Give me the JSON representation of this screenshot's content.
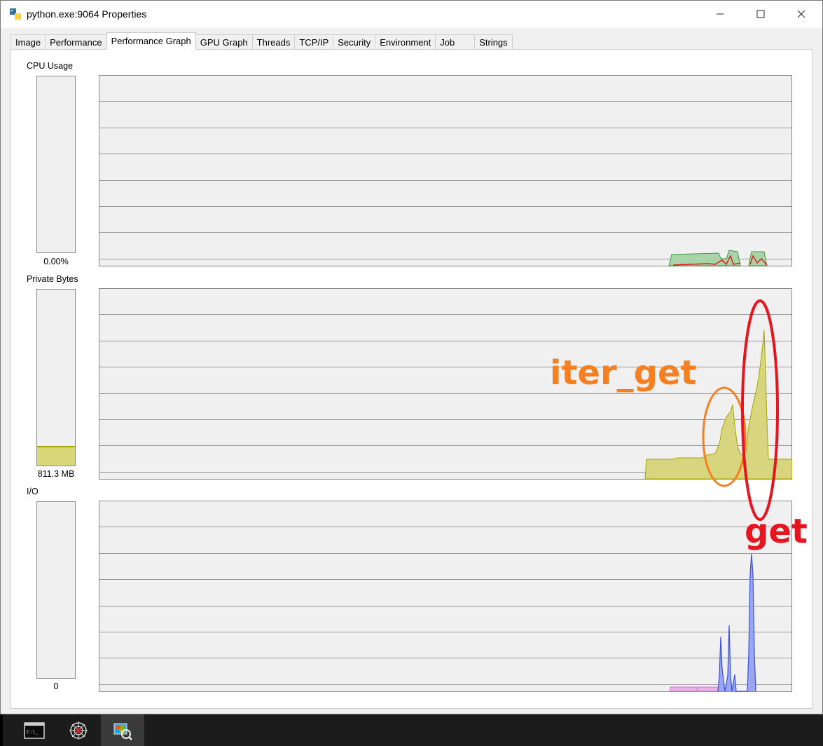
{
  "window": {
    "title": "python.exe:9064 Properties",
    "minimize_glyph": "—",
    "maximize_glyph": "☐",
    "close_glyph": "✕"
  },
  "tabs": [
    {
      "label": "Image"
    },
    {
      "label": "Performance"
    },
    {
      "label": "Performance Graph",
      "active": true
    },
    {
      "label": "GPU Graph"
    },
    {
      "label": "Threads"
    },
    {
      "label": "TCP/IP"
    },
    {
      "label": "Security"
    },
    {
      "label": "Environment"
    },
    {
      "label": "Job"
    },
    {
      "label": "Strings"
    }
  ],
  "sections": {
    "cpu": {
      "label": "CPU Usage",
      "value": "0.00%",
      "fill_fraction": 0.0
    },
    "private_bytes": {
      "label": "Private Bytes",
      "value": "811.3 MB",
      "fill_fraction": 0.11
    },
    "io": {
      "label": "I/O",
      "value": "0",
      "fill_fraction": 0.0
    }
  },
  "annotations": {
    "iter_get": {
      "text": "iter_get",
      "color": "#f57f21"
    },
    "get": {
      "text": "get",
      "color": "#e8141f"
    }
  },
  "colors": {
    "cpu_total": "#6ab36a",
    "cpu_kernel": "#e02020",
    "private_bytes": "#c8c84a",
    "io_read": "#3a50e0",
    "io_other": "#d46ad4",
    "grid": "#9a9a9a"
  },
  "taskbar": {
    "items": [
      {
        "name": "terminal-icon",
        "glyph": "C:\\_"
      },
      {
        "name": "spider-icon",
        "glyph": "☸"
      },
      {
        "name": "process-explorer-icon",
        "glyph": "⧉",
        "active": true
      }
    ]
  }
}
